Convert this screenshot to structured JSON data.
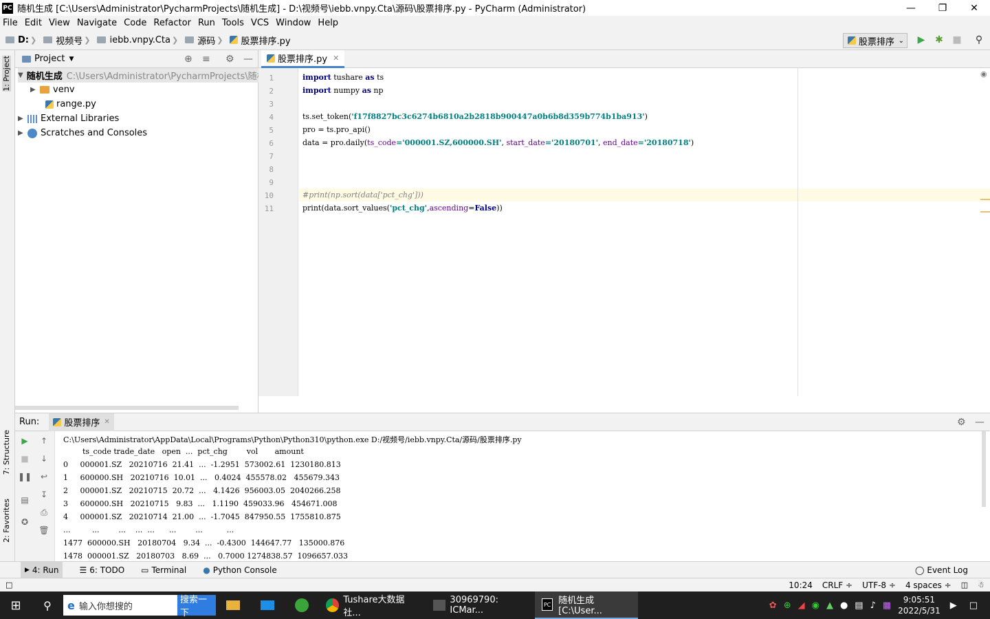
{
  "window": {
    "title": "随机生成 [C:\\Users\\Administrator\\PycharmProjects\\随机生成] - D:\\视频号\\iebb.vnpy.Cta\\源码\\股票排序.py - PyCharm (Administrator)",
    "logo": "PC"
  },
  "menu": [
    "File",
    "Edit",
    "View",
    "Navigate",
    "Code",
    "Refactor",
    "Run",
    "Tools",
    "VCS",
    "Window",
    "Help"
  ],
  "breadcrumb": [
    "D:",
    "视频号",
    "iebb.vnpy.Cta",
    "源码",
    "股票排序.py"
  ],
  "run_config": "股票排序",
  "left_strip": {
    "project_tab": "1: Project",
    "structure_tab": "7: Structure",
    "favorites_tab": "2: Favorites"
  },
  "project": {
    "header": "Project",
    "root_name": "随机生成",
    "root_path": "C:\\Users\\Administrator\\PycharmProjects\\随机",
    "items": [
      "venv",
      "range.py",
      "External Libraries",
      "Scratches and Consoles"
    ]
  },
  "editor": {
    "tab": "股票排序.py",
    "line_numbers": [
      "1",
      "2",
      "3",
      "4",
      "5",
      "6",
      "7",
      "8",
      "9",
      "10",
      "11"
    ],
    "code": {
      "l1_kw": "import",
      "l1_mod": " tushare ",
      "l1_as": "as",
      "l1_alias": " ts",
      "l2_kw": "import",
      "l2_mod": " numpy ",
      "l2_as": "as",
      "l2_alias": " np",
      "l4_pre": "ts.set_token(",
      "l4_str": "'f17f8827bc3c6274b6810a2b2818b900447a0b6b8d359b774b1ba913'",
      "l4_post": ")",
      "l5": "pro = ts.pro_api()",
      "l6_pre": "data = pro.daily(",
      "l6_p1": "ts_code",
      "l6_s1": "='000001.SZ,600000.SH'",
      "l6_c1": ", ",
      "l6_p2": "start_date",
      "l6_s2": "='20180701'",
      "l6_c2": ", ",
      "l6_p3": "end_date",
      "l6_s3": "='20180718'",
      "l6_post": ")",
      "l10": "#print(np.sort(data['pct_chg']))",
      "l11_pre": "print(data.sort_values(",
      "l11_str": "'pct_chg'",
      "l11_c": ",",
      "l11_p": "ascending",
      "l11_eq": "=",
      "l11_kw": "False",
      "l11_post": "))"
    }
  },
  "run": {
    "label": "Run:",
    "tab": "股票排序",
    "lines": [
      "C:\\Users\\Administrator\\AppData\\Local\\Programs\\Python\\Python310\\python.exe D:/视频号/iebb.vnpy.Cta/源码/股票排序.py",
      "        ts_code trade_date   open  ...  pct_chg        vol       amount",
      "0     000001.SZ   20210716  21.41  ...  -1.2951  573002.61  1230180.813",
      "1     600000.SH   20210716  10.01  ...   0.4024  455578.02   455679.343",
      "2     000001.SZ   20210715  20.72  ...   4.1426  956003.05  2040266.258",
      "3     600000.SH   20210715   9.83  ...   1.1190  459033.96   454671.008",
      "4     000001.SZ   20210714  21.00  ...  -1.7045  847950.55  1755810.875",
      "...         ...        ...    ...  ...      ...        ...          ...",
      "1477  600000.SH   20180704   9.34  ...  -0.4300  144647.77   135000.876",
      "1478  000001.SZ   20180703   8.69  ...   0.7000 1274838.57  1096657.033"
    ]
  },
  "bottom_tabs": [
    "4: Run",
    "6: TODO",
    "Terminal",
    "Python Console"
  ],
  "event_log": "Event Log",
  "status": {
    "position": "10:24",
    "line_sep": "CRLF ÷",
    "encoding": "UTF-8 ÷",
    "indent": "4 spaces ÷"
  },
  "taskbar": {
    "search_placeholder": "输入你想搜的",
    "search_button": "搜索一下",
    "apps": [
      "Tushare大数据社...",
      "30969790: ICMar...",
      "随机生成 [C:\\User..."
    ],
    "time": "9:05:51",
    "date": "2022/5/31"
  },
  "colors": {
    "keyword": "#000080",
    "string": "#008080",
    "param": "#660099",
    "comment": "#808080",
    "accent": "#4083c9"
  }
}
